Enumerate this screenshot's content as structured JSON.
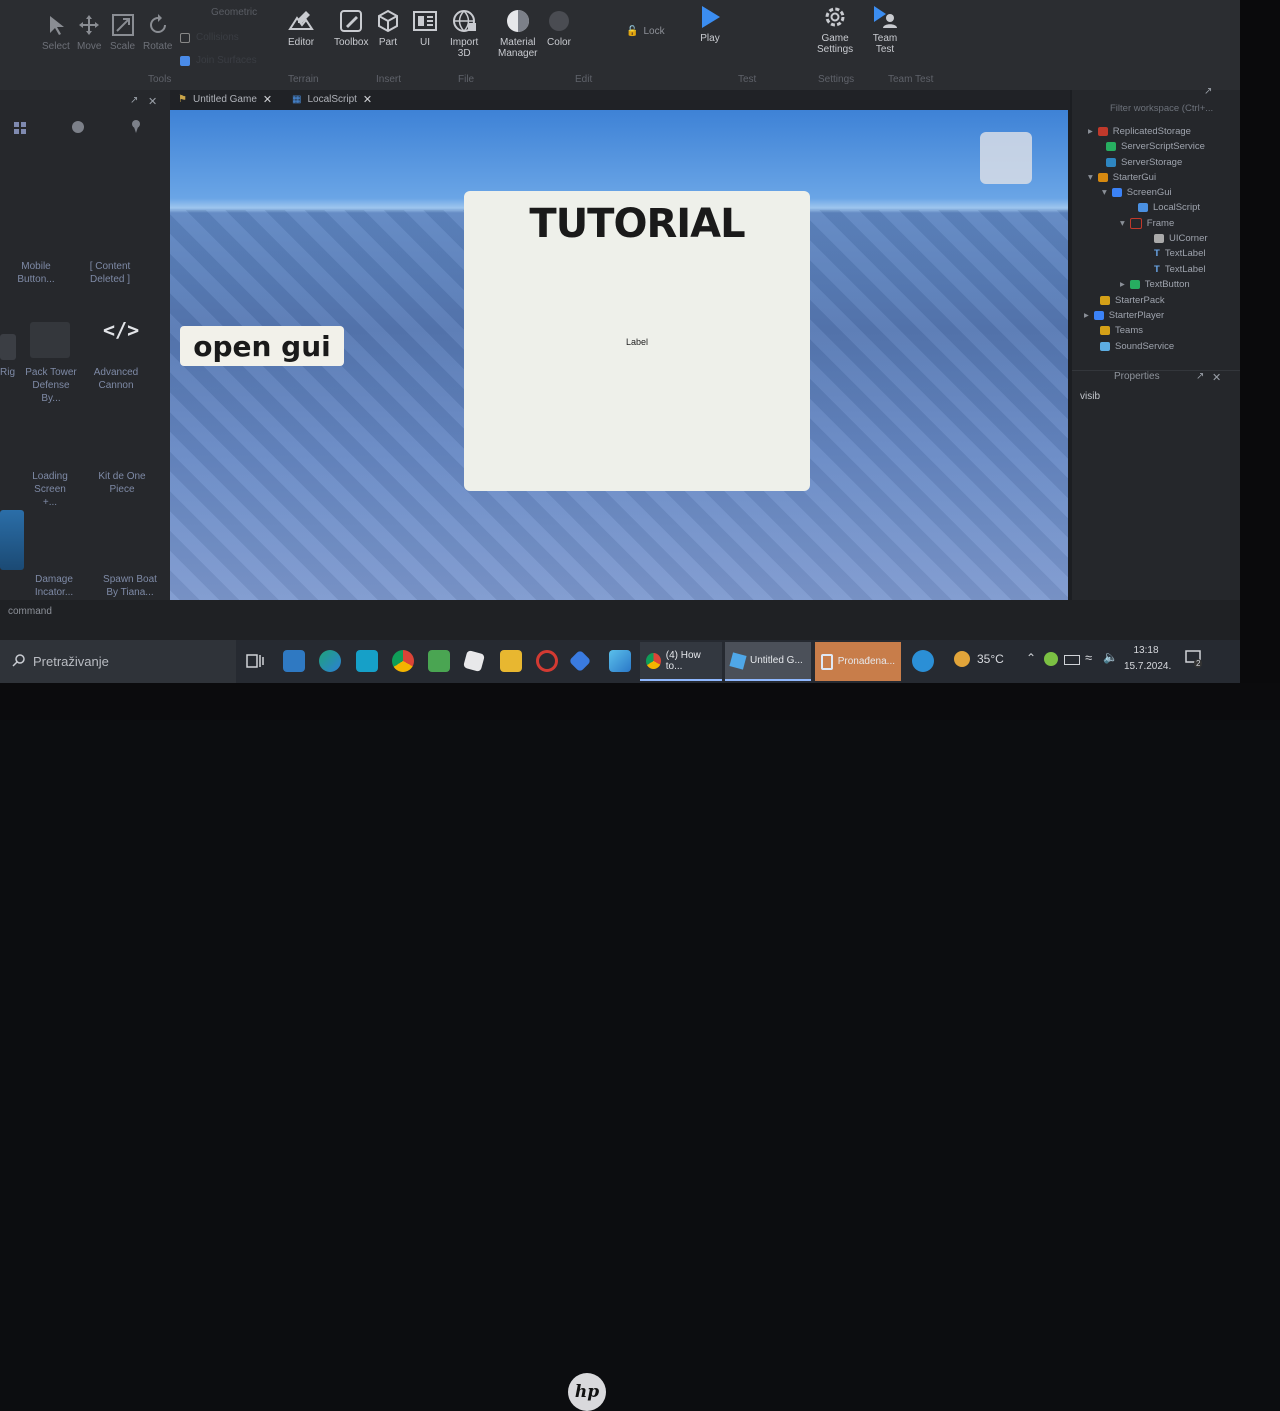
{
  "ribbon": {
    "tools": [
      {
        "label": "Select"
      },
      {
        "label": "Move"
      },
      {
        "label": "Scale"
      },
      {
        "label": "Rotate"
      }
    ],
    "geometric_label": "Geometric",
    "checkbox_1": "Collisions",
    "checkbox_2": "Join Surfaces",
    "buttons": {
      "editor": "Editor",
      "toolbox": "Toolbox",
      "part": "Part",
      "ui": "UI",
      "import3d_line1": "Import",
      "import3d_line2": "3D",
      "material_line1": "Material",
      "material_line2": "Manager",
      "color": "Color",
      "lock": "Lock",
      "play": "Play",
      "game_settings_line1": "Game",
      "game_settings_line2": "Settings",
      "team_test_line1": "Team",
      "team_test_line2": "Test"
    },
    "groups": {
      "tools": "Tools",
      "terrain": "Terrain",
      "insert": "Insert",
      "file": "File",
      "edit": "Edit",
      "test": "Test",
      "settings": "Settings",
      "team_test": "Team Test"
    }
  },
  "toolbox": {
    "items": [
      {
        "line1": "Mobile",
        "line2": "Button..."
      },
      {
        "line1": "[ Content",
        "line2": "Deleted ]"
      },
      {
        "line1": "Rig",
        "line2": ""
      },
      {
        "line1": "Pack Tower",
        "line2": "Defense By..."
      },
      {
        "line1": "Advanced",
        "line2": "Cannon"
      },
      {
        "line1": "Loading",
        "line2": "Screen +..."
      },
      {
        "line1": "Kit de One",
        "line2": "Piece"
      },
      {
        "line1": "Damage",
        "line2": "Incator..."
      },
      {
        "line1": "Spawn Boat",
        "line2": "By Tiana..."
      }
    ]
  },
  "tabs": [
    {
      "label": "Untitled Game"
    },
    {
      "label": "LocalScript"
    }
  ],
  "viewport": {
    "frame_title": "TUTORIAL",
    "frame_label": "Label",
    "open_button": "open gui"
  },
  "explorer": {
    "filter_placeholder": "Filter workspace (Ctrl+...",
    "items": [
      {
        "label": "ReplicatedStorage",
        "color": "#c0392b"
      },
      {
        "label": "ServerScriptService",
        "color": "#27ae60"
      },
      {
        "label": "ServerStorage",
        "color": "#2e86c1"
      },
      {
        "label": "StarterGui",
        "color": "#d68910"
      },
      {
        "label": "ScreenGui",
        "color": "#3b82f6"
      },
      {
        "label": "LocalScript",
        "color": "#4a90e2"
      },
      {
        "label": "Frame",
        "color": "#c0392b"
      },
      {
        "label": "UICorner",
        "color": "#aaaaaa"
      },
      {
        "label": "TextLabel",
        "color": "#6aa7e8"
      },
      {
        "label": "TextLabel",
        "color": "#6aa7e8"
      },
      {
        "label": "TextButton",
        "color": "#27ae60"
      },
      {
        "label": "StarterPack",
        "color": "#d4a017"
      },
      {
        "label": "StarterPlayer",
        "color": "#3b82f6"
      },
      {
        "label": "Teams",
        "color": "#d4a017"
      },
      {
        "label": "SoundService",
        "color": "#5dade2"
      }
    ]
  },
  "properties": {
    "title": "Properties",
    "search_value": "visib"
  },
  "command": {
    "label": "command"
  },
  "taskbar": {
    "search_label": "Pretraživanje",
    "apps": [
      {
        "label": "(4) How to..."
      },
      {
        "label": "Untitled G..."
      },
      {
        "label": "Pronađena..."
      }
    ],
    "temperature": "35°C",
    "time": "13:18",
    "date": "15.7.2024.",
    "notification_count": "2"
  },
  "logo": {
    "label": "hp"
  }
}
